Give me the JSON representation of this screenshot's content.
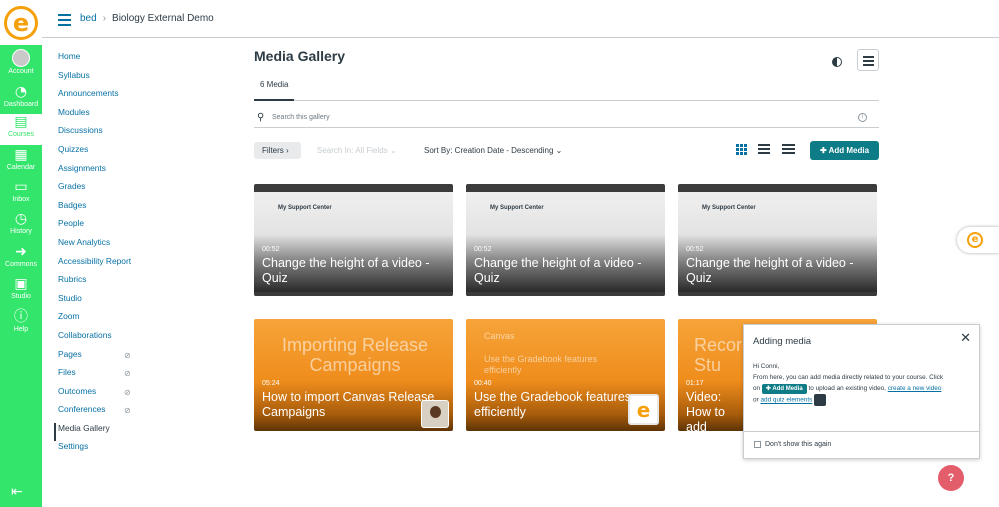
{
  "global_nav": {
    "items": [
      {
        "label": "Account",
        "icon": "avatar"
      },
      {
        "label": "Dashboard",
        "icon": "dashboard-icon"
      },
      {
        "label": "Courses",
        "icon": "courses-icon"
      },
      {
        "label": "Calendar",
        "icon": "calendar-icon"
      },
      {
        "label": "Inbox",
        "icon": "inbox-icon"
      },
      {
        "label": "History",
        "icon": "history-icon"
      },
      {
        "label": "Commons",
        "icon": "commons-icon"
      },
      {
        "label": "Studio",
        "icon": "studio-icon"
      },
      {
        "label": "Help",
        "icon": "help-icon"
      }
    ],
    "active": "Courses",
    "accent": "#33e66b"
  },
  "breadcrumb": {
    "course": "bed",
    "page": "Biology External Demo"
  },
  "course_nav": {
    "items": [
      {
        "label": "Home"
      },
      {
        "label": "Syllabus"
      },
      {
        "label": "Announcements"
      },
      {
        "label": "Modules"
      },
      {
        "label": "Discussions"
      },
      {
        "label": "Quizzes"
      },
      {
        "label": "Assignments"
      },
      {
        "label": "Grades"
      },
      {
        "label": "Badges"
      },
      {
        "label": "People"
      },
      {
        "label": "New Analytics"
      },
      {
        "label": "Accessibility Report"
      },
      {
        "label": "Rubrics"
      },
      {
        "label": "Studio"
      },
      {
        "label": "Zoom"
      },
      {
        "label": "Collaborations"
      },
      {
        "label": "Pages",
        "hidden": true
      },
      {
        "label": "Files",
        "hidden": true
      },
      {
        "label": "Outcomes",
        "hidden": true
      },
      {
        "label": "Conferences",
        "hidden": true
      },
      {
        "label": "Media Gallery",
        "active": true
      },
      {
        "label": "Settings"
      }
    ]
  },
  "gallery": {
    "title": "Media Gallery",
    "tab_label": "6 Media",
    "search_placeholder": "Search this gallery",
    "filters_label": "Filters",
    "search_in_label": "Search In: All Fields",
    "sort_label": "Sort By: Creation Date - Descending",
    "add_media_label": "Add Media",
    "accent": "#0e7c86"
  },
  "media": [
    {
      "duration": "00:52",
      "title": "Change the height of a video - Quiz",
      "style": "shot",
      "thumb_text": "My Support Center"
    },
    {
      "duration": "00:52",
      "title": "Change the height of a video - Quiz",
      "style": "shot",
      "thumb_text": "My Support Center"
    },
    {
      "duration": "00:52",
      "title": "Change the height of a video - Quiz",
      "style": "shot",
      "thumb_text": "My Support Center"
    },
    {
      "duration": "05:24",
      "title": "How to import Canvas Release Campaigns",
      "style": "orange",
      "thumb_text": "Importing Release Campaigns"
    },
    {
      "duration": "00:40",
      "title": "Use the Gradebook features efficiently",
      "style": "orange",
      "thumb_text": "Canvas",
      "thumb_sub": "Use the Gradebook features efficiently"
    },
    {
      "duration": "01:17",
      "title": "Video: How to add video/audi",
      "style": "orange",
      "thumb_text": "Record for Stu"
    }
  ],
  "popup": {
    "title": "Adding media",
    "greeting": "Hi Conni,",
    "line1": "From here, you can add media directly related to your course. Click",
    "on": "on",
    "btn": "Add Media",
    "line2": "to upload an existing video,",
    "link1": "create a new video",
    "or": "or",
    "link2": "add quiz elements",
    "dont_show": "Don't show this again"
  },
  "help_fab": "?"
}
